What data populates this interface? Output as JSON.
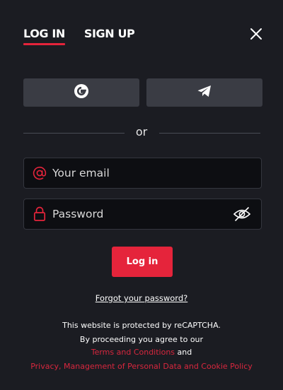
{
  "tabs": [
    {
      "label": "LOG IN",
      "active": true
    },
    {
      "label": "SIGN UP",
      "active": false
    }
  ],
  "icons": {
    "close": "close-icon",
    "google": "google-icon",
    "telegram": "telegram-icon",
    "email": "at-icon",
    "password": "lock-icon",
    "visibility": "eye-slash-icon"
  },
  "divider": {
    "text": "or"
  },
  "email_field": {
    "placeholder": "Your email",
    "value": ""
  },
  "password_field": {
    "placeholder": "Password",
    "value": ""
  },
  "login_button": {
    "label": "Log in"
  },
  "forgot_link": {
    "label": "Forgot your password?"
  },
  "legal": {
    "line1": "This website is protected by reCAPTCHA.",
    "line2": "By proceeding you agree to our",
    "terms_link": "Terms and Conditions",
    "and_text": "and",
    "privacy_link": "Privacy, Management of Personal Data and Cookie Policy"
  },
  "colors": {
    "background": "#1b1c22",
    "accent": "#e5243b",
    "button_bg": "#3a3c44",
    "field_bg": "#0d0e12"
  }
}
